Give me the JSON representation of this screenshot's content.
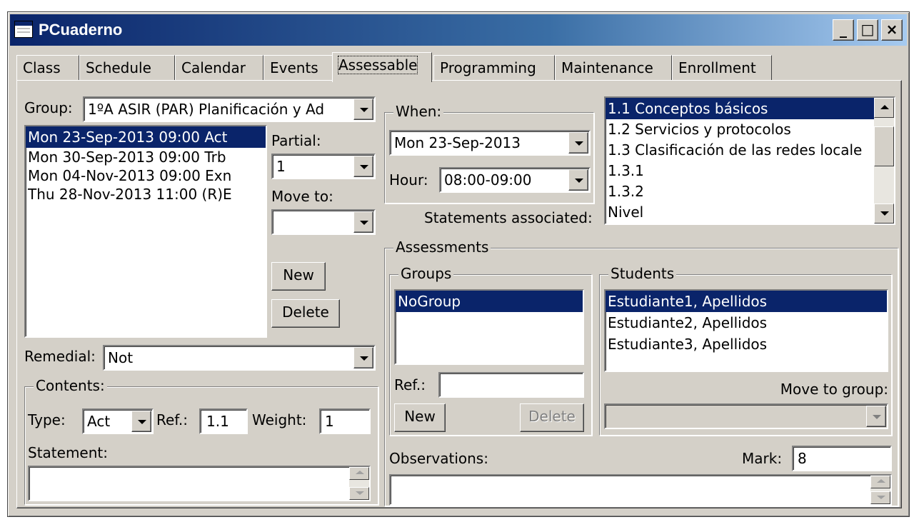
{
  "window": {
    "title": "PCuaderno",
    "minimize": "_",
    "maximize": "□",
    "close": "×"
  },
  "tabs": [
    "Class",
    "Schedule",
    "Calendar",
    "Events",
    "Assessable",
    "Programming",
    "Maintenance",
    "Enrollment"
  ],
  "left": {
    "group_label": "Group:",
    "group_value": "1ºA ASIR (PAR) Planificación y Ad",
    "events": [
      "Mon 23-Sep-2013 09:00 Act",
      "Mon 30-Sep-2013 09:00 Trb",
      "Mon 04-Nov-2013 09:00 Exn",
      "Thu 28-Nov-2013 11:00 (R)E"
    ],
    "partial_label": "Partial:",
    "partial_value": "1",
    "move_to_label": "Move to:",
    "move_to_value": "",
    "new_button": "New",
    "delete_button": "Delete",
    "remedial_label": "Remedial:",
    "remedial_value": "Not",
    "contents": {
      "legend": "Contents:",
      "type_label": "Type:",
      "type_value": "Act",
      "ref_label": "Ref.:",
      "ref_value": "1.1",
      "weight_label": "Weight:",
      "weight_value": "1",
      "statement_label": "Statement:"
    }
  },
  "when": {
    "legend": "When:",
    "date_value": "Mon 23-Sep-2013",
    "hour_label": "Hour:",
    "hour_value": "08:00-09:00"
  },
  "statements": {
    "label": "Statements associated:",
    "items": [
      "1.1 Conceptos básicos",
      "1.2 Servicios y protocolos",
      "1.3 Clasificación de las redes locale",
      "1.3.1",
      "1.3.2",
      "Nivel"
    ]
  },
  "assessments": {
    "legend": "Assessments",
    "groups": {
      "legend": "Groups",
      "items": [
        "NoGroup"
      ],
      "ref_label": "Ref.:",
      "ref_value": "",
      "new_button": "New",
      "delete_button": "Delete"
    },
    "students": {
      "legend": "Students",
      "items": [
        "Estudiante1, Apellidos",
        "Estudiante2, Apellidos",
        "Estudiante3, Apellidos"
      ],
      "move_to_group_label": "Move to group:",
      "move_to_group_value": ""
    },
    "observations_label": "Observations:",
    "mark_label": "Mark:",
    "mark_value": "8"
  }
}
